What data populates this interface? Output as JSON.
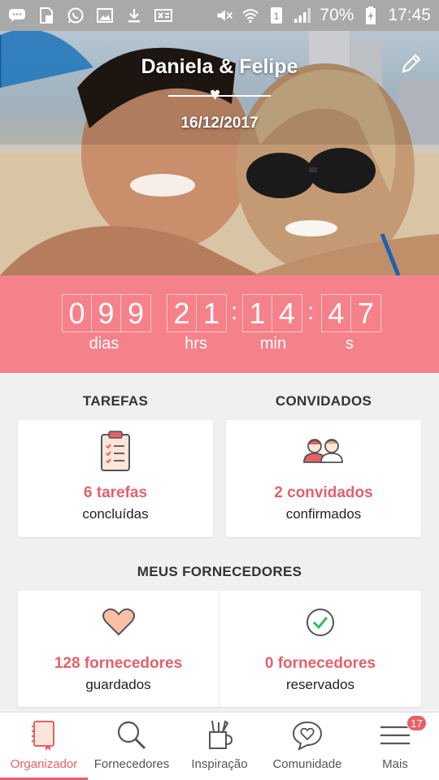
{
  "status_bar": {
    "battery": "70%",
    "time": "17:45",
    "icons": [
      "chat-bubble-icon",
      "sim-icon",
      "whatsapp-icon",
      "image-icon",
      "download-icon",
      "screenshot-icon",
      "mute-icon",
      "wifi-icon",
      "sim1-icon",
      "signal-icon",
      "battery-charging-icon"
    ]
  },
  "hero": {
    "title": "Daniela & Felipe",
    "date": "16/12/2017",
    "heart_glyph": "♥",
    "edit_icon": "pencil-icon"
  },
  "countdown": {
    "days_digits": [
      "0",
      "9",
      "9"
    ],
    "hours_digits": [
      "2",
      "1"
    ],
    "minutes_digits": [
      "1",
      "4"
    ],
    "seconds_digits": [
      "4",
      "7"
    ],
    "labels": {
      "days": "dias",
      "hours": "hrs",
      "minutes": "min",
      "seconds": "s"
    },
    "separator": ":"
  },
  "tasks": {
    "section_title": "TAREFAS",
    "count_text": "6 tarefas",
    "sub_text": "concluídas",
    "icon": "clipboard-checklist-icon"
  },
  "guests": {
    "section_title": "CONVIDADOS",
    "count_text": "2 convidados",
    "sub_text": "confirmados",
    "icon": "couple-icon"
  },
  "vendors": {
    "section_title": "MEUS FORNECEDORES",
    "saved": {
      "count_text": "128 fornecedores",
      "sub_text": "guardados",
      "icon": "heart-icon"
    },
    "booked": {
      "count_text": "0 fornecedores",
      "sub_text": "reservados",
      "icon": "check-circle-icon"
    }
  },
  "bottom_nav": {
    "items": [
      {
        "label": "Organizador",
        "icon": "notebook-icon",
        "active": true
      },
      {
        "label": "Fornecedores",
        "icon": "search-icon",
        "active": false
      },
      {
        "label": "Inspiração",
        "icon": "tools-cup-icon",
        "active": false
      },
      {
        "label": "Comunidade",
        "icon": "chat-heart-icon",
        "active": false
      },
      {
        "label": "Mais",
        "icon": "menu-icon",
        "active": false
      }
    ],
    "badge": "17"
  },
  "colors": {
    "accent": "#e6606a",
    "countdown_bg": "#f5828a",
    "page_bg": "#f0f0f0",
    "status_bar_bg": "#a9a9a9"
  }
}
